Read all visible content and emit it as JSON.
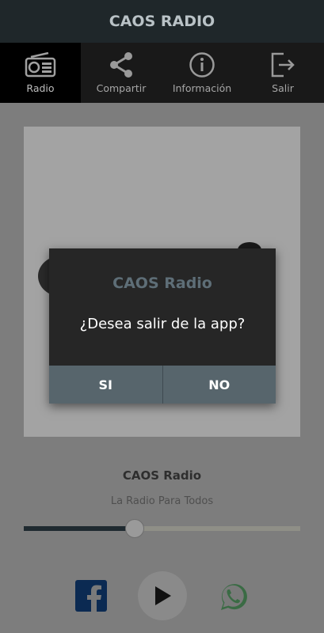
{
  "app_bar": {
    "title": "CAOS RADIO"
  },
  "tabs": [
    {
      "label": "Radio",
      "icon": "radio-icon",
      "active": true
    },
    {
      "label": "Compartir",
      "icon": "share-icon",
      "active": false
    },
    {
      "label": "Información",
      "icon": "info-icon",
      "active": false
    },
    {
      "label": "Salir",
      "icon": "exit-icon",
      "active": false
    }
  ],
  "player": {
    "station_name": "CAOS Radio",
    "tagline": "La Radio Para Todos",
    "volume_fraction": 0.4
  },
  "social": {
    "facebook_icon": "facebook-icon",
    "play_icon": "play-icon",
    "whatsapp_icon": "whatsapp-icon"
  },
  "dialog": {
    "title": "CAOS Radio",
    "message": "¿Desea salir de la app?",
    "confirm_label": "SI",
    "cancel_label": "NO"
  },
  "colors": {
    "title_bar": "#1f272a",
    "tab_bar": "#191919",
    "dialog_bg": "#262626",
    "dialog_button": "#57656c",
    "dialog_title": "#5e6e77",
    "facebook_blue": "#0b2a52",
    "whatsapp_green": "#25d366"
  }
}
